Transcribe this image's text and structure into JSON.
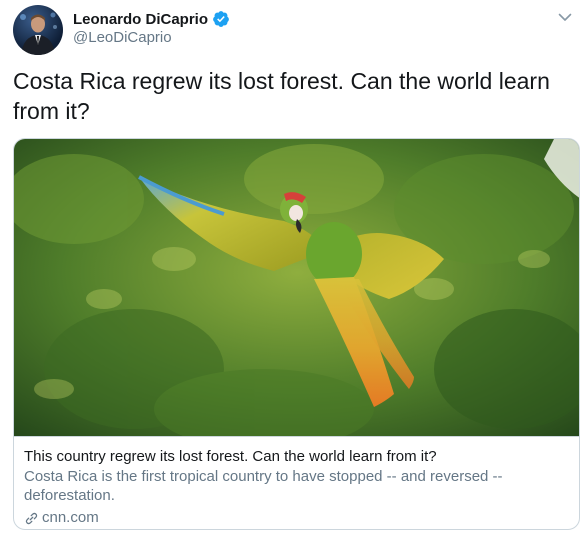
{
  "author": {
    "name": "Leonardo DiCaprio",
    "handle": "@LeoDiCaprio",
    "verified_icon": "verified-badge-icon",
    "verified_color": "#1da1f2"
  },
  "tweet": {
    "text": "Costa Rica regrew its lost forest. Can the world learn from it?"
  },
  "card": {
    "image_icon": "macaw-photo",
    "title": "This country regrew its lost forest. Can the world learn from it?",
    "description": "Costa Rica is the first tropical country to have stopped -- and reversed -- deforestation.",
    "domain": "cnn.com",
    "link_icon": "link-icon"
  },
  "menu": {
    "icon": "chevron-down-icon"
  }
}
